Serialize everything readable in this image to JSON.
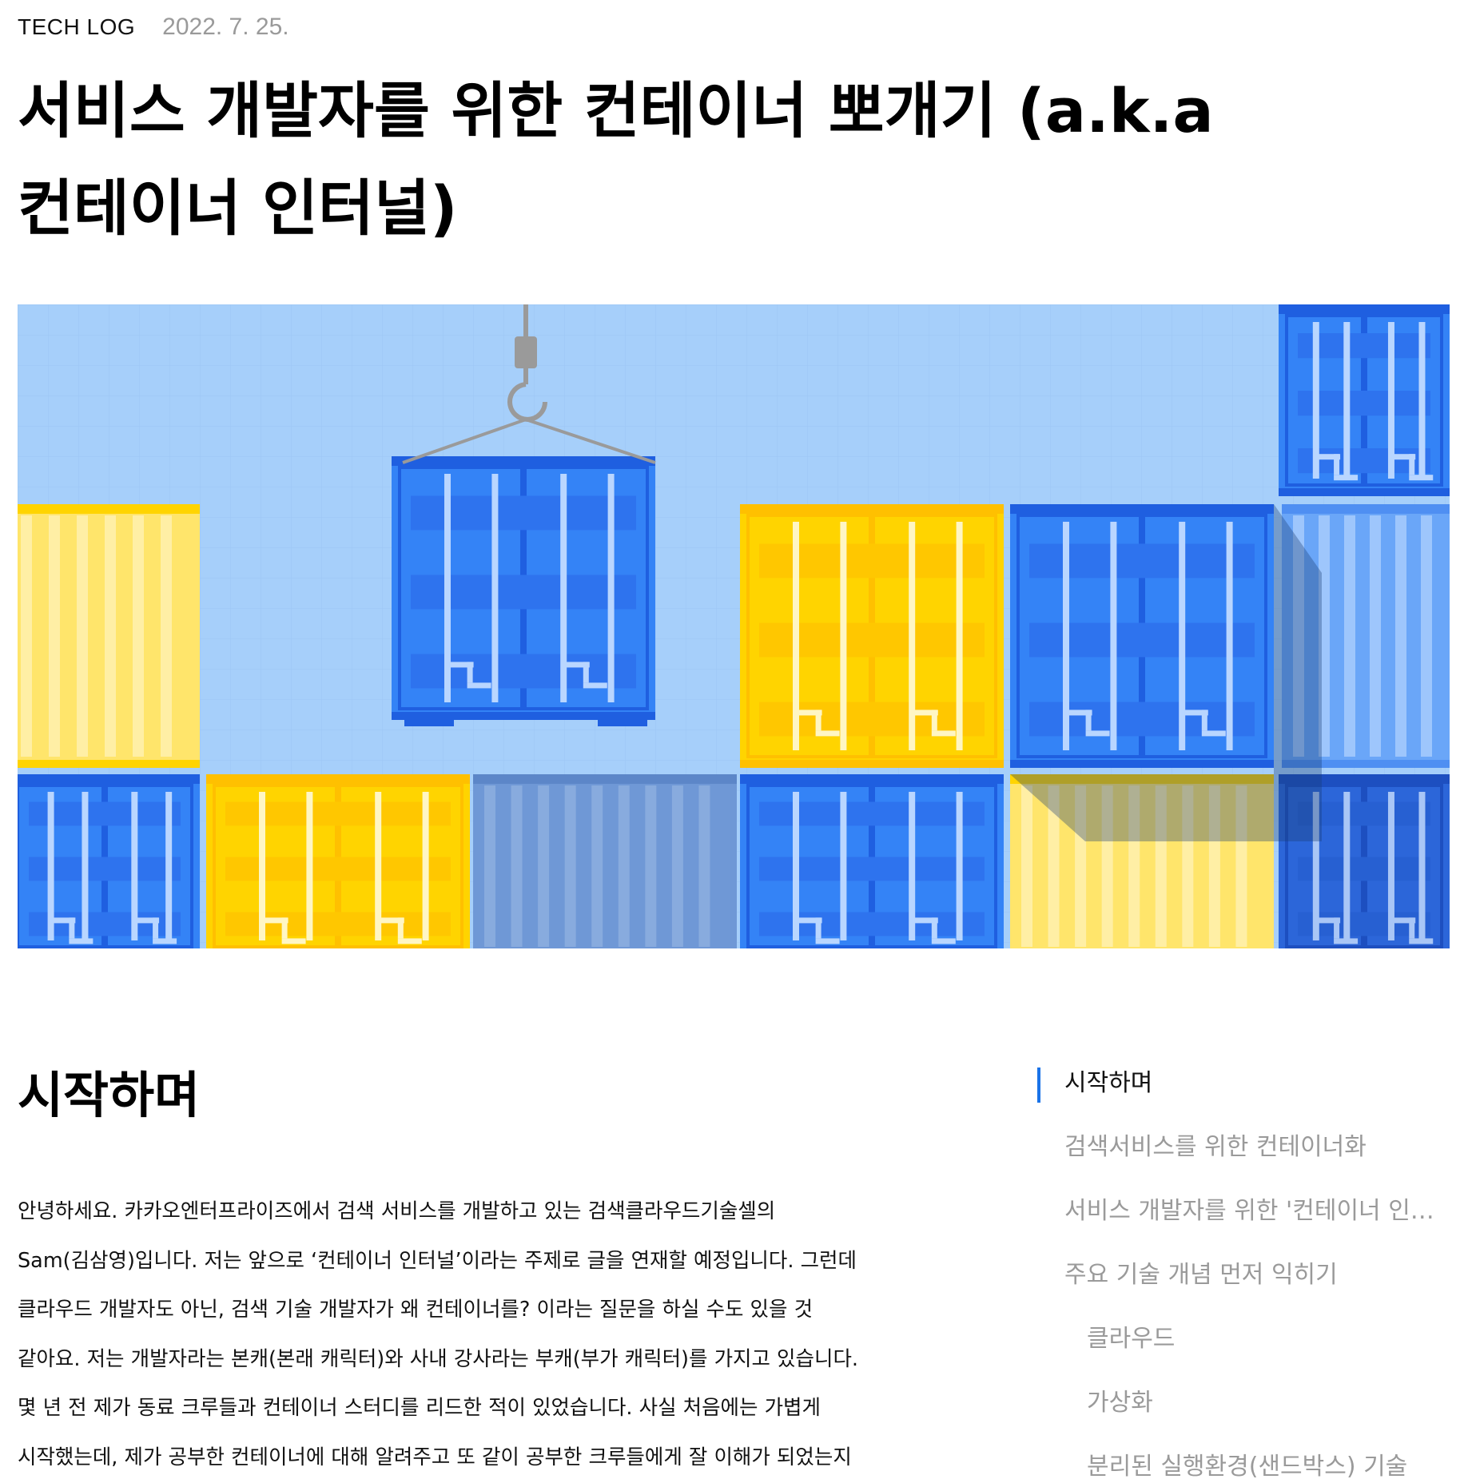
{
  "header": {
    "category": "TECH LOG",
    "date": "2022. 7. 25."
  },
  "article": {
    "title_line1": "서비스 개발자를 위한 컨테이너 뽀개기 (a.k.a",
    "title_line2": "컨테이너 인터널)",
    "hero_image": "container-crane-illustration",
    "section_title": "시작하며",
    "paragraph_lines": [
      "안녕하세요. 카카오엔터프라이즈에서 검색 서비스를 개발하고 있는 검색클라우드기술셀의",
      "Sam(김삼영)입니다.  저는 앞으로 ‘컨테이너 인터널’이라는 주제로 글을 연재할 예정입니다. 그런데",
      "클라우드 개발자도 아닌, 검색 기술 개발자가 왜 컨테이너를? 이라는 질문을 하실 수도 있을 것",
      "같아요. 저는 개발자라는 본캐(본래 캐릭터)와 사내 강사라는 부캐(부가 캐릭터)를 가지고 있습니다.",
      "몇 년 전 제가 동료 크루들과 컨테이너 스터디를 리드한 적이 있었습니다. 사실 처음에는 가볍게",
      "시작했는데, 제가 공부한 컨테이너에 대해 알려주고 또 같이 공부한 크루들에게 잘 이해가 되었는지"
    ]
  },
  "toc": {
    "items": [
      {
        "label": "시작하며",
        "active": true
      },
      {
        "label": "검색서비스를 위한 컨테이너화"
      },
      {
        "label": "서비스 개발자를 위한 '컨테이너 인터널'"
      },
      {
        "label": "주요 기술 개념 먼저 익히기"
      },
      {
        "label": "클라우드"
      },
      {
        "label": "가상화"
      },
      {
        "label": "분리된 실행환경(샌드박스) 기술"
      }
    ]
  },
  "colors": {
    "accent": "#1a73e8",
    "sky": "#a6cffa",
    "container_blue": "#3483f6",
    "container_yellow": "#ffd400"
  }
}
